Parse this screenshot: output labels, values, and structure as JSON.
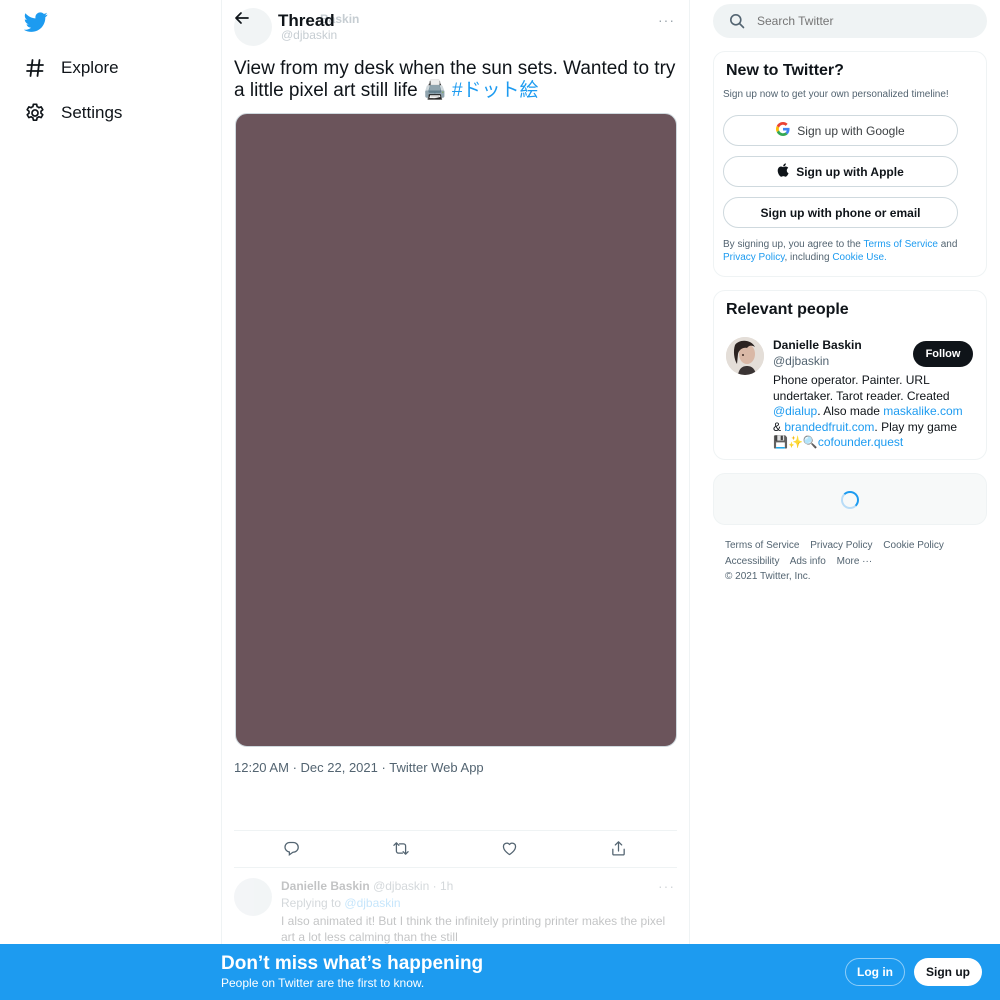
{
  "nav": {
    "logo_icon": "twitter-bird-icon",
    "items": [
      {
        "label": "Explore",
        "icon": "hashtag-icon"
      },
      {
        "label": "Settings",
        "icon": "gear-icon"
      }
    ]
  },
  "header": {
    "title": "Thread",
    "ghost_name": "Baskin",
    "ghost_handle": "@djbaskin"
  },
  "tweet": {
    "text": "View from my desk when the sun sets. Wanted to try a little pixel art still life 🖨️",
    "hashtag": "#ドット絵",
    "media_color": "#6b545b",
    "time": "12:20 AM",
    "date": "Dec 22, 2021",
    "source": "Twitter Web App",
    "separator": "·"
  },
  "reply": {
    "name": "Danielle Baskin",
    "handle": "@djbaskin",
    "time": "1h",
    "separator": "·",
    "replying_prefix": "Replying to",
    "replying_to": "@djbaskin",
    "text": "I also animated it! But I think the infinitely printing printer makes the pixel art a lot less calming than the still"
  },
  "search": {
    "placeholder": "Search Twitter"
  },
  "new_to_twitter": {
    "title": "New to Twitter?",
    "subtitle": "Sign up now to get your own personalized timeline!",
    "google_label": "Sign up with Google",
    "apple_label": "Sign up with Apple",
    "phone_label": "Sign up with phone or email",
    "legal_prefix": "By signing up, you agree to the",
    "terms": "Terms of Service",
    "and": "and",
    "privacy": "Privacy Policy",
    "including": ", including",
    "cookie": "Cookie Use."
  },
  "relevant_people": {
    "title": "Relevant people",
    "name": "Danielle Baskin",
    "handle": "@djbaskin",
    "follow_label": "Follow",
    "bio_1": "Phone operator. Painter. URL undertaker. Tarot reader. Created",
    "bio_link_1": "@dialup",
    "bio_2": ". Also made",
    "bio_link_2": "maskalike.com",
    "bio_3": "&",
    "bio_link_3": "brandedfruit.com",
    "bio_4": ". Play my game 💾✨🔍",
    "bio_link_4": "cofounder.quest"
  },
  "footer": {
    "links": [
      "Terms of Service",
      "Privacy Policy",
      "Cookie Policy",
      "Accessibility",
      "Ads info",
      "More ···"
    ],
    "copyright": "© 2021 Twitter, Inc."
  },
  "bottom_bar": {
    "title": "Don’t miss what’s happening",
    "subtitle": "People on Twitter are the first to know.",
    "login_label": "Log in",
    "signup_label": "Sign up"
  },
  "colors": {
    "brand": "#1d9bf0",
    "text": "#0f1419",
    "secondary": "#536471"
  }
}
